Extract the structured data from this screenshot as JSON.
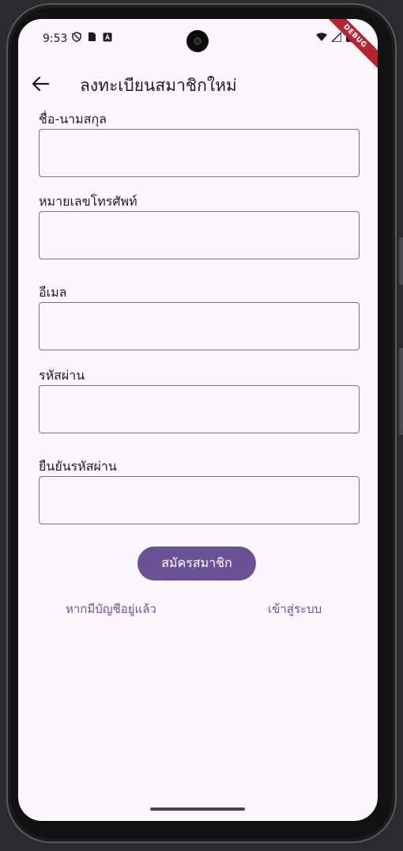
{
  "status_bar": {
    "time": "9:53",
    "left_icons": [
      "shield-icon",
      "sim-card-icon",
      "keyboard-icon"
    ],
    "right_icons": [
      "wifi-icon",
      "signal-icon",
      "battery-icon"
    ]
  },
  "debug_banner": "DEBUG",
  "app_bar": {
    "title": "ลงทะเบียนสมาชิกใหม่",
    "back_icon": "arrow-back-icon"
  },
  "form": {
    "fields": [
      {
        "label": "ชื่อ-นามสกุล",
        "value": ""
      },
      {
        "label": "หมายเลขโทรศัพท์",
        "value": ""
      },
      {
        "label": "อีเมล",
        "value": ""
      },
      {
        "label": "รหัสผ่าน",
        "value": ""
      },
      {
        "label": "ยืนยันรหัสผ่าน",
        "value": ""
      }
    ],
    "submit_label": "สมัครสมาชิก"
  },
  "footer": {
    "prompt_text": "หากมีบัญชีอยู่แล้ว",
    "login_link": "เข้าสู่ระบบ"
  },
  "colors": {
    "background": "#fcf7fd",
    "primary": "#6b5296",
    "outline": "#79747e",
    "on_surface": "#1d1b20",
    "debug_banner": "#b3262f"
  }
}
